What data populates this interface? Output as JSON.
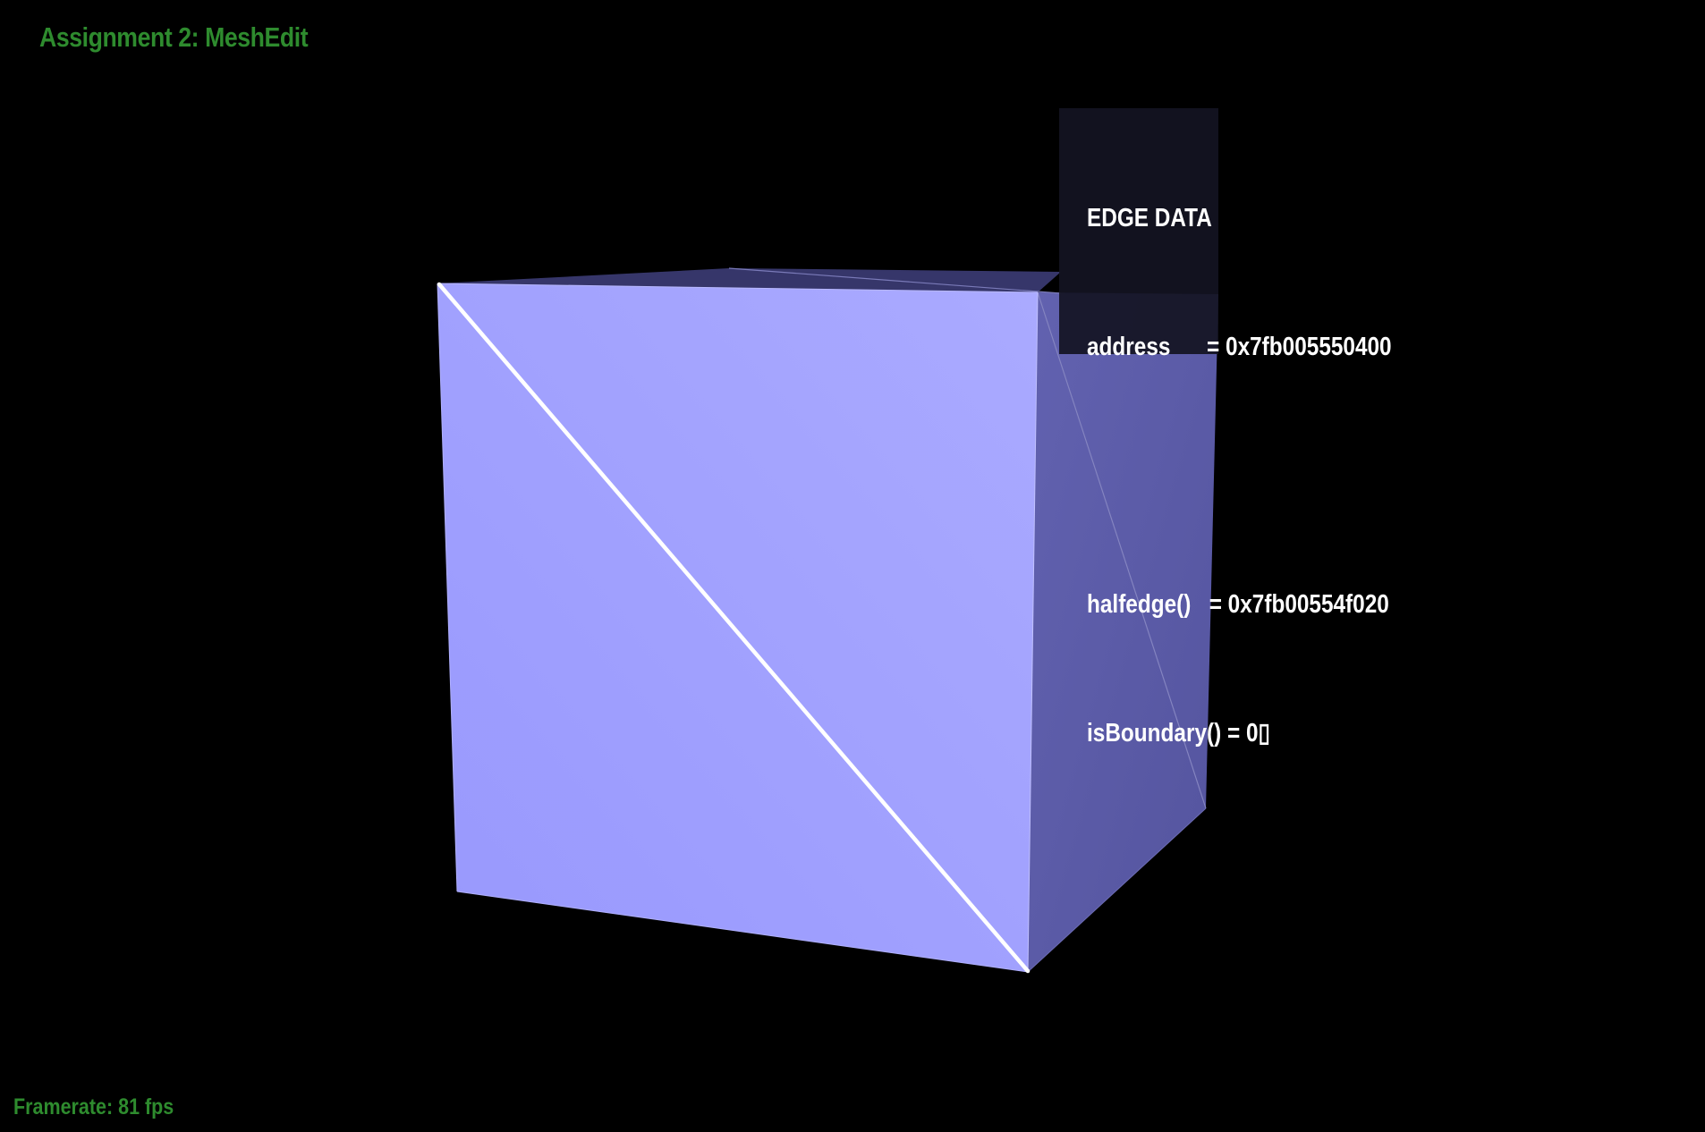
{
  "app": {
    "title": "Assignment 2: MeshEdit",
    "title_color": "#2e8b2e",
    "framerate_text": "Framerate: 81 fps",
    "framerate_color": "#2e8b2e"
  },
  "edge_data": {
    "heading": "EDGE DATA",
    "address_label": "address      = 0x7fb005550400",
    "halfedge_label": "halfedge()   = 0x7fb00554f020",
    "is_boundary_label": "isBoundary() = 0▯"
  },
  "colors": {
    "background": "#000000",
    "front_face": "#a3a3ff",
    "side_face": "#5a5aa8",
    "top_face": "#3a3a6e",
    "selected_edge": "#ffffff",
    "wire_edge": "#8c8cc4"
  }
}
